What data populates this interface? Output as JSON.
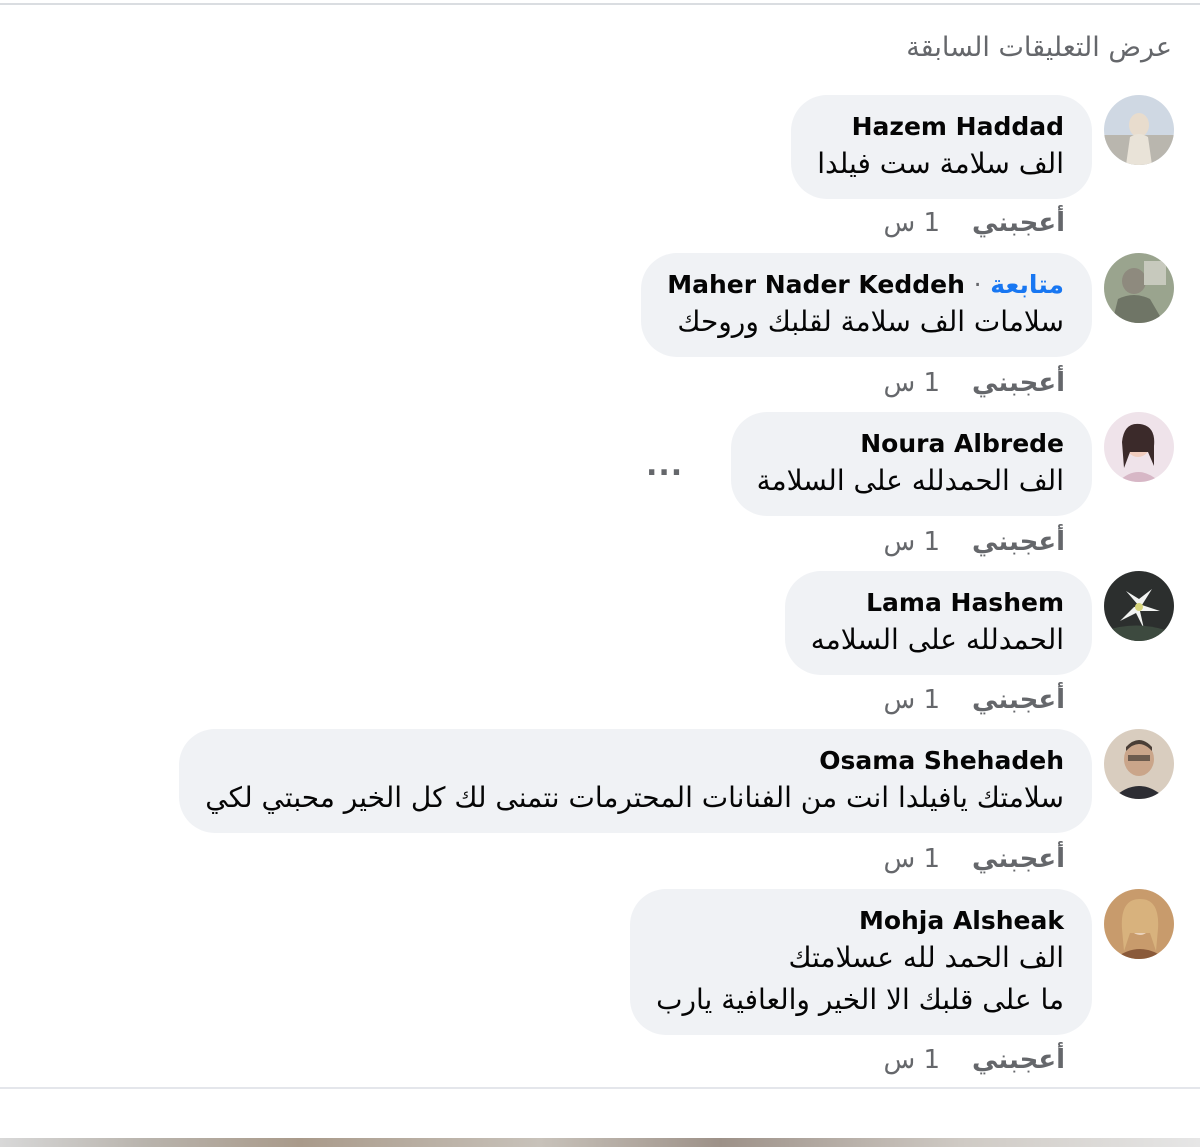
{
  "header": {
    "view_previous_label": "عرض التعليقات السابقة"
  },
  "comments": [
    {
      "author": "Hazem Haddad",
      "lines": [
        "الف سلامة ست فيلدا"
      ],
      "like_label": "أعجبني",
      "time": "1 س"
    },
    {
      "author": "Maher Nader Keddeh",
      "follow_label": "متابعة",
      "separator": "·",
      "lines": [
        "سلامات الف سلامة لقلبك وروحك"
      ],
      "like_label": "أعجبني",
      "time": "1 س"
    },
    {
      "author": "Noura Albrede",
      "lines": [
        "الف الحمدلله على السلامة"
      ],
      "like_label": "أعجبني",
      "time": "1 س",
      "more_label": "..."
    },
    {
      "author": "Lama Hashem",
      "lines": [
        "الحمدلله على السلامه"
      ],
      "like_label": "أعجبني",
      "time": "1 س"
    },
    {
      "author": "Osama Shehadeh",
      "lines": [
        "سلامتك يافيلدا انت من الفنانات المحترمات نتمنى لك كل الخير محبتي لكي"
      ],
      "like_label": "أعجبني",
      "time": "1 س"
    },
    {
      "author": "Mohja Alsheak",
      "lines": [
        "الف الحمد لله عسلامتك",
        "ما على قلبك الا الخير والعافية يارب"
      ],
      "like_label": "أعجبني",
      "time": "1 س"
    }
  ],
  "colors": {
    "bubble": "#f0f2f5",
    "secondary_text": "#65676b",
    "link_blue": "#1877f2",
    "primary_text": "#050505"
  }
}
